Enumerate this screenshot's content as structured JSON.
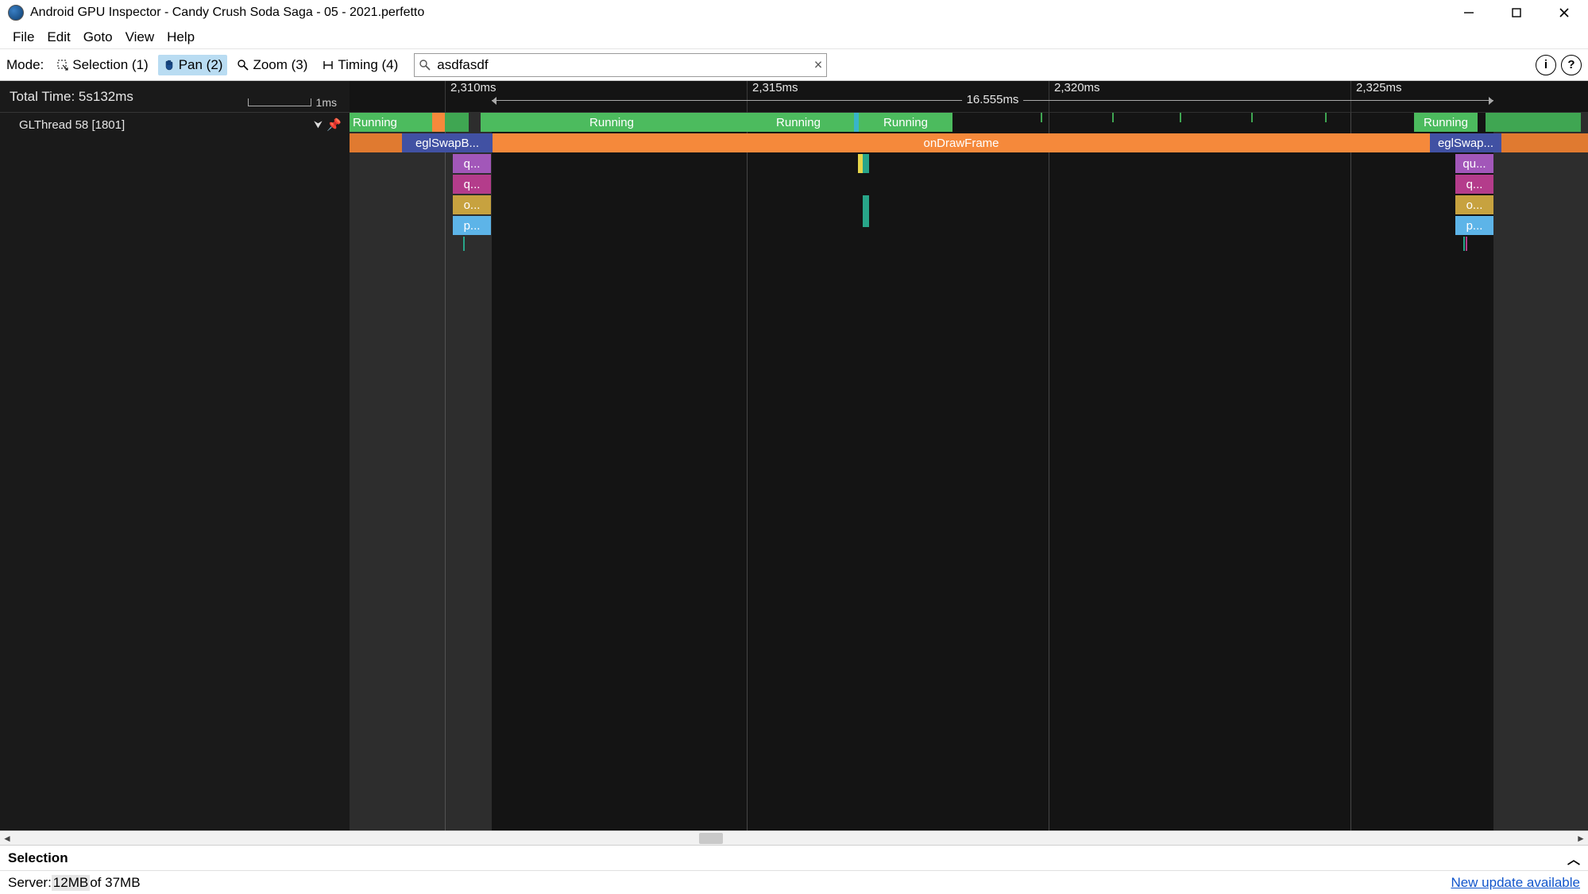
{
  "window": {
    "title": "Android GPU Inspector - Candy Crush Soda Saga - 05 - 2021.perfetto"
  },
  "menu": {
    "items": [
      "File",
      "Edit",
      "Goto",
      "View",
      "Help"
    ]
  },
  "toolbar": {
    "mode_label": "Mode:",
    "modes": {
      "selection": "Selection (1)",
      "pan": "Pan (2)",
      "zoom": "Zoom (3)",
      "timing": "Timing (4)"
    },
    "active_mode": "pan",
    "search_value": "asdfasdf"
  },
  "trace": {
    "total_time_label": "Total Time: 5s132ms",
    "scale_hint": "1ms",
    "thread_label": "GLThread 58 [1801]",
    "selection_span_label": "16.555ms",
    "ticks": [
      "2,310ms",
      "2,315ms",
      "2,320ms",
      "2,325ms"
    ],
    "lane0": {
      "running1": "Running",
      "running2": "Running",
      "running3": "Running",
      "running4": "Running",
      "running5": "Running"
    },
    "lane1": {
      "swap1": "eglSwapB...",
      "ondraw": "onDrawFrame",
      "swap2": "eglSwap..."
    },
    "lane2": {
      "q1": "q...",
      "qu2": "qu..."
    },
    "lane3": {
      "q1": "q...",
      "q2": "q..."
    },
    "lane4": {
      "o1": "o...",
      "o2": "o..."
    },
    "lane5": {
      "p1": "p...",
      "p2": "p..."
    }
  },
  "selection_panel": {
    "title": "Selection"
  },
  "status": {
    "server_prefix": "Server: ",
    "mem_used": "12MB",
    "mem_mid": " of 37MB",
    "update_link": "New update available"
  }
}
